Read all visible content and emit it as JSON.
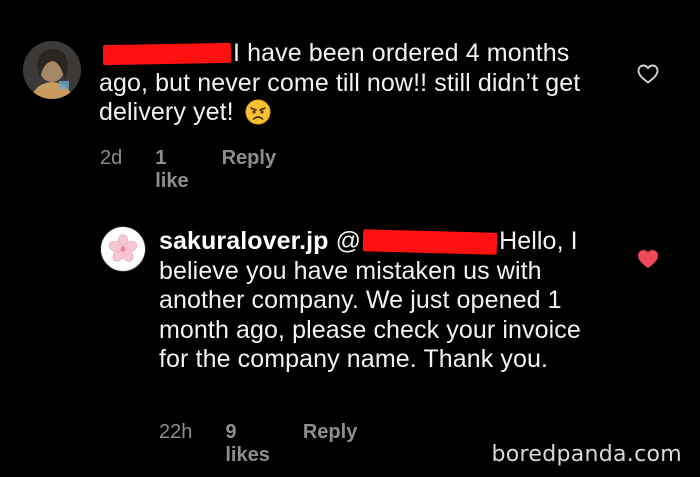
{
  "comments": [
    {
      "text": "I have been ordered 4 months ago, but never come till now!! still didn’t get delivery yet!",
      "emoji": "angry-face",
      "time": "2d",
      "likes": "1 like",
      "reply": "Reply",
      "liked": false
    },
    {
      "username": "sakuralover.jp",
      "mention_prefix": "@",
      "text": "Hello, I believe you have mistaken us with another company. We just opened 1 month ago, please check your invoice for the company name. Thank you.",
      "time": "22h",
      "likes": "9 likes",
      "reply": "Reply",
      "liked": true
    }
  ],
  "colors": {
    "background": "#000000",
    "text": "#f2f2f2",
    "meta": "#8e8e8e",
    "redaction": "#ff1111",
    "heart_liked": "#ed4956",
    "heart_outline": "#d0d0d0"
  },
  "watermark": "boredpanda.com"
}
